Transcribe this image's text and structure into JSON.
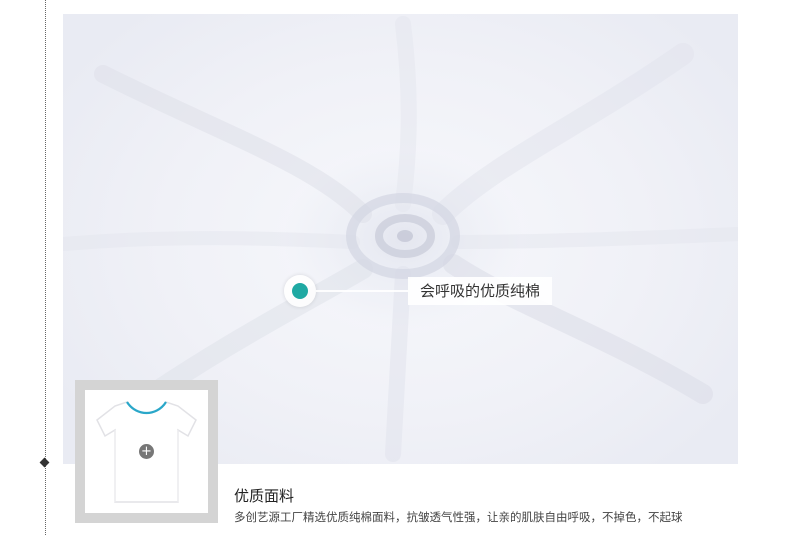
{
  "hotspot": {
    "label": "会呼吸的优质纯棉",
    "accent_color": "#1fa9a3"
  },
  "thumbnail": {
    "icon": "plus-icon",
    "plus_glyph": "+"
  },
  "caption": {
    "title": "优质面料",
    "description": "多创艺源工厂精选优质纯棉面料，抗皱透气性强，让亲的肌肤自由呼吸，不掉色，不起球"
  }
}
